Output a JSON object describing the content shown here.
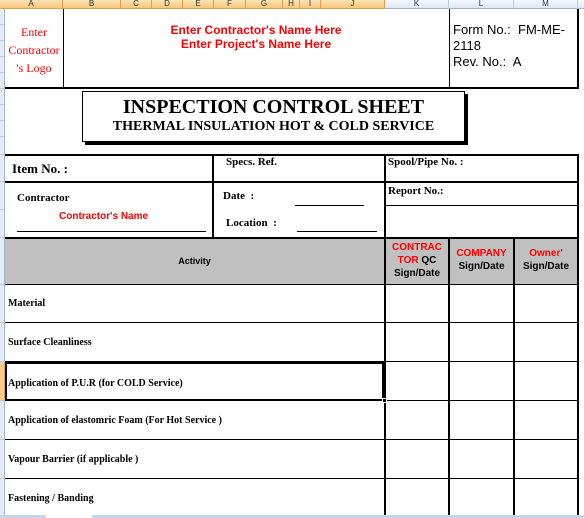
{
  "spreadsheet": {
    "columns": [
      "A",
      "B",
      "C",
      "D",
      "E",
      "F",
      "G",
      "H",
      "I",
      "J",
      "K",
      "L",
      "M"
    ]
  },
  "header": {
    "logo_placeholder": [
      "Enter",
      "Contractor",
      "'s Logo"
    ],
    "contractor_name_placeholder": "Enter Contractor's Name Here",
    "project_name_placeholder": "Enter Project's Name Here",
    "form_no_label": "Form No.:",
    "form_no_value_line1": "FM-ME-",
    "form_no_value_line2": "2118",
    "rev_no_label": "Rev. No.:",
    "rev_no_value": "A"
  },
  "title": {
    "main": "INSPECTION CONTROL SHEET",
    "sub": "THERMAL INSULATION HOT & COLD SERVICE"
  },
  "info": {
    "item_no_label": "Item No. :",
    "specs_ref_label": "Specs. Ref.",
    "spool_pipe_label": "Spool/Pipe No. :",
    "contractor_label": "Contractor",
    "contractor_name": "Contractor's Name",
    "date_label": "Date",
    "date_colon": ":",
    "location_label": "Location",
    "location_colon": ":",
    "report_no_label": "Report No.:"
  },
  "table": {
    "headers": {
      "activity": "Activity",
      "contractor_red_1": "CONTRAC",
      "contractor_red_2": "TOR",
      "contractor_qc": "QC",
      "contractor_sign": "Sign/Date",
      "company_red": "COMPANY",
      "company_sign": "Sign/Date",
      "owner_red": "Owner'",
      "owner_sign": "Sign/Date"
    },
    "rows": [
      {
        "activity": "Material"
      },
      {
        "activity": "Surface Cleanliness"
      },
      {
        "activity": "Application of P.U.R  (for COLD Service)"
      },
      {
        "activity": "Application of elastomric Foam (For Hot Service )"
      },
      {
        "activity": "Vapour Barrier (if applicable )"
      },
      {
        "activity": "Fastening / Banding"
      }
    ],
    "selected_row_index": 2
  },
  "colors": {
    "accent_red": "#ff0000",
    "header_gray": "#c0c0c0",
    "selected_col_header": "#f6c77a"
  }
}
